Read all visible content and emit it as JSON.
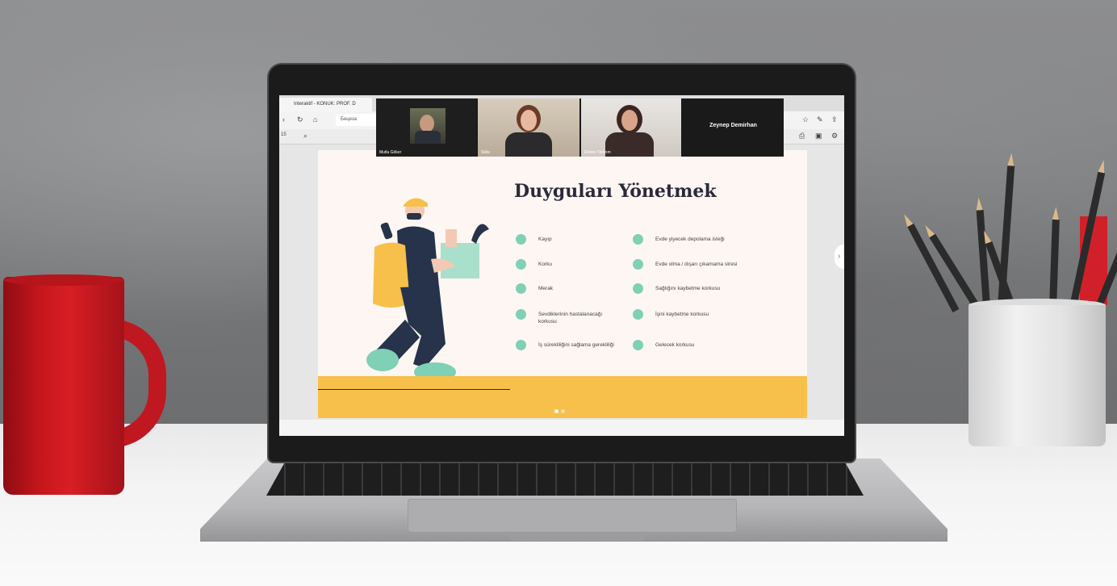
{
  "browser": {
    "tab_title": "Interaktif - KONUK: PROF. D",
    "address": "Бецеза",
    "page_number": "15",
    "icons": [
      "back-icon",
      "refresh-icon",
      "home-icon",
      "search-icon",
      "star-icon",
      "pen-icon",
      "share-icon",
      "print-icon",
      "save-icon",
      "settings-icon"
    ]
  },
  "zoom": {
    "participants": [
      {
        "name": "Mutlu Göker"
      },
      {
        "name": "Slide"
      },
      {
        "name": "Emine Yıldırım"
      }
    ],
    "speaker": "Zeynep Demirhan"
  },
  "slide": {
    "title": "Duyguları Yönetmek",
    "left_items": [
      "Kayıp",
      "Korku",
      "Merak",
      "Sevdiklerinin hastalanacağı korkusu",
      "İş sürekliliğini sağlama gerekliliği"
    ],
    "right_items": [
      "Evde yiyecek depolama isteği",
      "Evde olma / dışarı çıkamama stresi",
      "Sağlığını kaybetme korkusu",
      "İşini kaybetme korkusu",
      "Gelecek korkusu"
    ],
    "accent_color": "#f7c04a",
    "bullet_color": "#7fd0b5"
  }
}
